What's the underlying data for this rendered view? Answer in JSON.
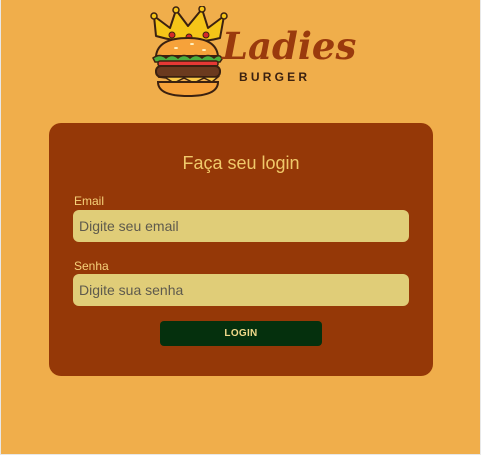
{
  "brand": {
    "name": "Ladies",
    "subtitle": "BURGER",
    "logo_icon": "crowned-burger-icon"
  },
  "login_form": {
    "title": "Faça seu login",
    "email_label": "Email",
    "email_placeholder": "Digite seu email",
    "email_value": "",
    "password_label": "Senha",
    "password_placeholder": "Digite sua senha",
    "password_value": "",
    "submit_label": "LOGIN"
  },
  "colors": {
    "page_background": "#f0ae4b",
    "card_background": "#953807",
    "input_background": "#e0cd78",
    "button_background": "#05300d",
    "brand_text": "#9a3a0d",
    "label_text": "#f6d27a"
  }
}
